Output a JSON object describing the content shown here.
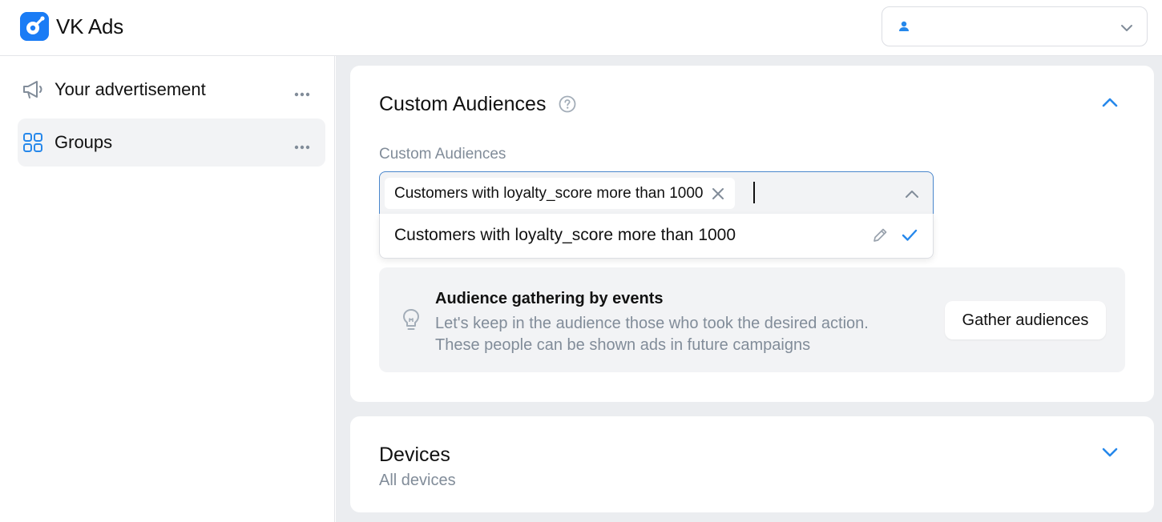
{
  "app": {
    "title": "VK Ads"
  },
  "account": {
    "icon": "user-icon",
    "dropdown_icon": "chevron-down-icon"
  },
  "sidebar": {
    "items": [
      {
        "label": "Your advertisement",
        "icon": "megaphone-icon",
        "active": false
      },
      {
        "label": "Groups",
        "icon": "grid-icon",
        "active": true
      }
    ]
  },
  "custom_audiences": {
    "title": "Custom Audiences",
    "field_label": "Custom Audiences",
    "selected_chip": "Customers with loyalty_score more than 1000",
    "options": [
      {
        "label": "Customers with loyalty_score more than 1000",
        "selected": true
      }
    ],
    "hint": {
      "title": "Audience gathering by events",
      "description": "Let's keep in the audience those who took the desired action. These people can be shown ads in future campaigns",
      "button": "Gather audiences"
    }
  },
  "devices": {
    "title": "Devices",
    "value": "All devices"
  },
  "colors": {
    "accent": "#2688eb",
    "field_border": "#4986cc",
    "muted_text": "#818c99",
    "panel_bg": "#ebedf0",
    "hint_bg": "#f2f3f5"
  }
}
